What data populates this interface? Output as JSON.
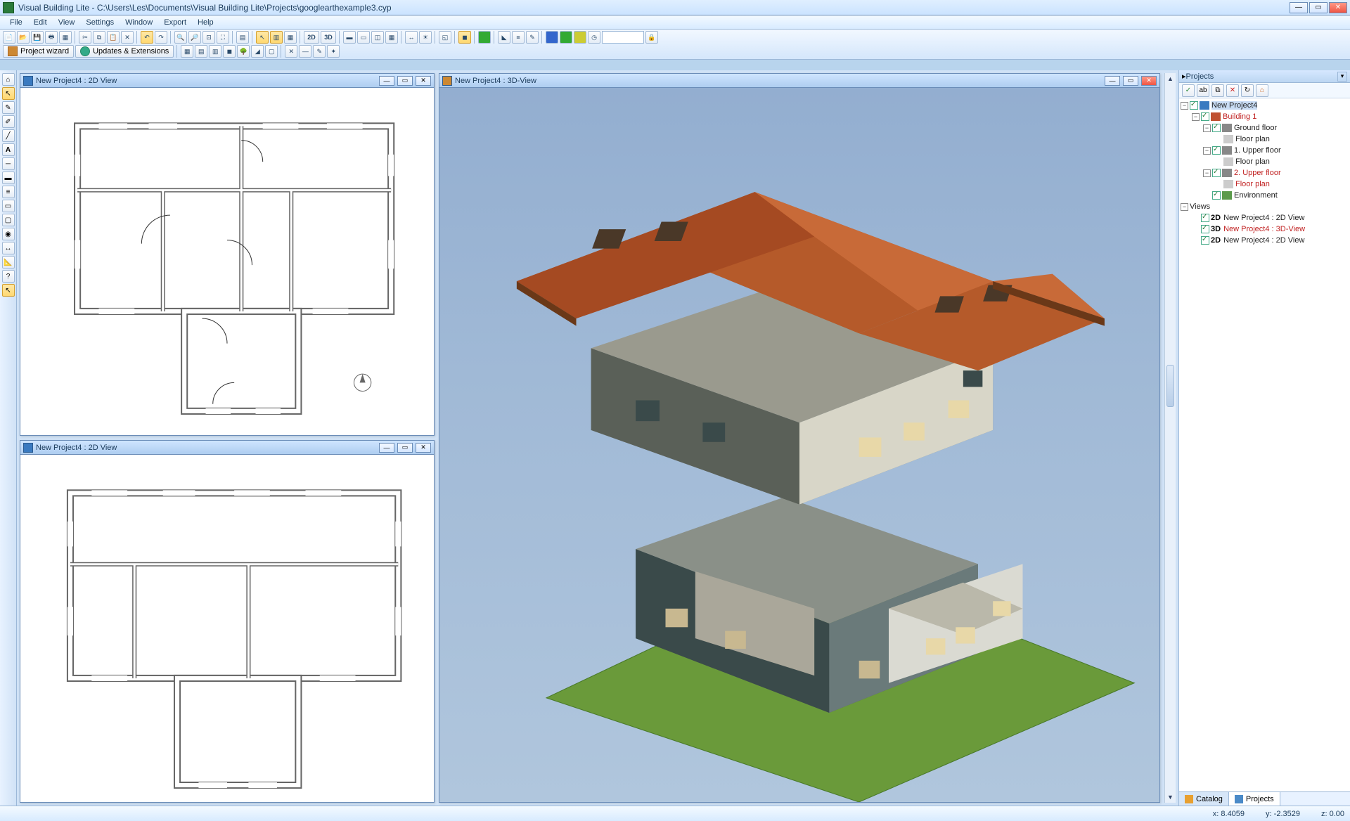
{
  "app": {
    "title": "Visual Building Lite - C:\\Users\\Les\\Documents\\Visual Building Lite\\Projects\\googlearthexample3.cyp"
  },
  "menu": [
    "File",
    "Edit",
    "View",
    "Settings",
    "Window",
    "Export",
    "Help"
  ],
  "toolbar_buttons_row1": [
    "new",
    "open",
    "save",
    "print",
    "template",
    "sep",
    "cut",
    "copy",
    "paste",
    "delete",
    "sep",
    "undo",
    "redo",
    "sep",
    "zoom-in",
    "zoom-out",
    "zoom-fit",
    "zoom-window",
    "sep",
    "layer",
    "sep",
    "select",
    "wall",
    "grid",
    "sep",
    "2d",
    "3d",
    "sep",
    "win1",
    "win2",
    "win3",
    "win4",
    "sep",
    "dim",
    "light",
    "sep",
    "group",
    "sep",
    "color",
    "color2",
    "sep",
    "roof",
    "stairs",
    "chair",
    "sep",
    "blue",
    "green",
    "yellow",
    "clock"
  ],
  "toolbar_labels": {
    "project_wizard": "Project wizard",
    "updates": "Updates & Extensions"
  },
  "toolbar_buttons_row2b": [
    "grid1",
    "grid2",
    "grid3",
    "fill",
    "tree",
    "area",
    "page",
    "sep",
    "tool",
    "dash",
    "paint",
    "star"
  ],
  "left_tools": [
    "home",
    "select",
    "edit",
    "pen",
    "draw",
    "text",
    "line",
    "wall",
    "list",
    "door",
    "win",
    "obj",
    "dim",
    "meas",
    "help",
    "pick"
  ],
  "views": {
    "v1": {
      "title": "New Project4 : 2D View"
    },
    "v2": {
      "title": "New Project4 : 2D View"
    },
    "v3": {
      "title": "New Project4 : 3D-View"
    }
  },
  "projects_panel": {
    "title": "Projects",
    "toolbar_icons": [
      "check",
      "rename",
      "dup",
      "delete",
      "refresh",
      "home"
    ],
    "tree": [
      {
        "depth": 0,
        "toggle": "−",
        "cb": true,
        "icon": "proj",
        "label": "New Project4",
        "sel": true
      },
      {
        "depth": 1,
        "toggle": "−",
        "cb": true,
        "icon": "bldg",
        "label": "Building 1",
        "red": true
      },
      {
        "depth": 2,
        "toggle": "−",
        "cb": true,
        "icon": "floor",
        "label": "Ground floor"
      },
      {
        "depth": 3,
        "toggle": "",
        "cb": false,
        "icon": "plan",
        "label": "Floor plan"
      },
      {
        "depth": 2,
        "toggle": "−",
        "cb": true,
        "icon": "floor",
        "label": "1. Upper floor"
      },
      {
        "depth": 3,
        "toggle": "",
        "cb": false,
        "icon": "plan",
        "label": "Floor plan"
      },
      {
        "depth": 2,
        "toggle": "−",
        "cb": true,
        "icon": "floor",
        "label": "2. Upper floor",
        "red": true
      },
      {
        "depth": 3,
        "toggle": "",
        "cb": false,
        "icon": "plan",
        "label": "Floor plan",
        "red": true
      },
      {
        "depth": 2,
        "toggle": "",
        "cb": true,
        "icon": "env",
        "label": "Environment"
      },
      {
        "depth": 0,
        "toggle": "−",
        "cb": false,
        "icon": "",
        "label": "Views"
      },
      {
        "depth": 1,
        "toggle": "",
        "cb": true,
        "icon": "2d",
        "prefix": "2D",
        "label": "New Project4 : 2D View"
      },
      {
        "depth": 1,
        "toggle": "",
        "cb": true,
        "icon": "3d",
        "prefix": "3D",
        "label": "New Project4 : 3D-View",
        "red": true
      },
      {
        "depth": 1,
        "toggle": "",
        "cb": true,
        "icon": "2d",
        "prefix": "2D",
        "label": "New Project4 : 2D View"
      }
    ],
    "tabs": {
      "catalog": "Catalog",
      "projects": "Projects"
    }
  },
  "status": {
    "x": "x: 8.4059",
    "y": "y: -2.3529",
    "z": "z: 0.00"
  }
}
